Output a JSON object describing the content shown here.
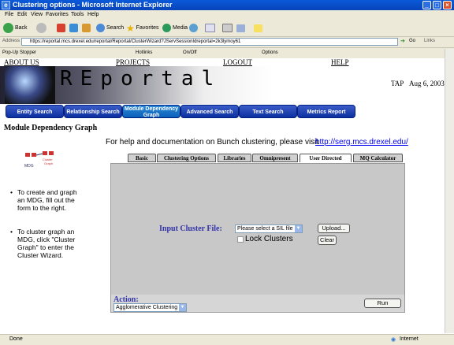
{
  "window": {
    "title": "Clustering options - Microsoft Internet Explorer"
  },
  "menu": [
    "File",
    "Edit",
    "View",
    "Favorites",
    "Tools",
    "Help"
  ],
  "toolbar": {
    "back": "Back",
    "search": "Search",
    "favorites": "Favorites",
    "media": "Media"
  },
  "address": {
    "label": "Address",
    "url": "https://reportal.mcs.drexel.edu/reportal/Reportal/ClusterWizard?JServSessionIdreportal=2k3lymoy61",
    "go": "Go",
    "links": "Links"
  },
  "popup_bar": {
    "label": "Pop-Up Stopper",
    "hotlinks": "Hotlinks",
    "onoff": "On/Off",
    "options": "Options"
  },
  "nav": {
    "about": "ABOUT US",
    "projects": "PROJECTS",
    "logout": "LOGOUT",
    "help": "HELP"
  },
  "banner": {
    "logo": "REportal",
    "user": "TAP",
    "date": "Aug 6, 2003"
  },
  "main_tabs": [
    "Entity Search",
    "Relationship Search",
    "Module Dependency Graph",
    "Advanced Search",
    "Text Search",
    "Metrics Report"
  ],
  "left": {
    "title": "Module Dependency Graph",
    "icon_label_left": "MDG",
    "icon_label_right": "Cluster Graph",
    "bullets": [
      "To create and graph an MDG, fill out the form to the right.",
      "To cluster graph an MDG, click \"Cluster Graph\" to enter the Cluster Wizard."
    ]
  },
  "help": {
    "text": "For help and documentation on Bunch clustering, please visit",
    "link": "http://serg.mcs.drexel.edu/"
  },
  "panel_tabs": [
    "Basic",
    "Clustering Options",
    "Libraries",
    "Omnipresent",
    "User Directed",
    "MQ Calculator"
  ],
  "form": {
    "input_label": "Input Cluster File:",
    "file_select": "Please select a SIL file",
    "upload": "Upload...",
    "clear": "Clear",
    "lock": "Lock Clusters",
    "action_label": "Action:",
    "action_select": "Agglomerative Clustering",
    "run": "Run"
  },
  "status": {
    "left": "Done",
    "zone": "Internet"
  },
  "colors": {
    "titlebar": "#0843b9",
    "tab_button": "#0c2fa0",
    "label_blue": "#3333aa",
    "link": "#0000ee"
  }
}
